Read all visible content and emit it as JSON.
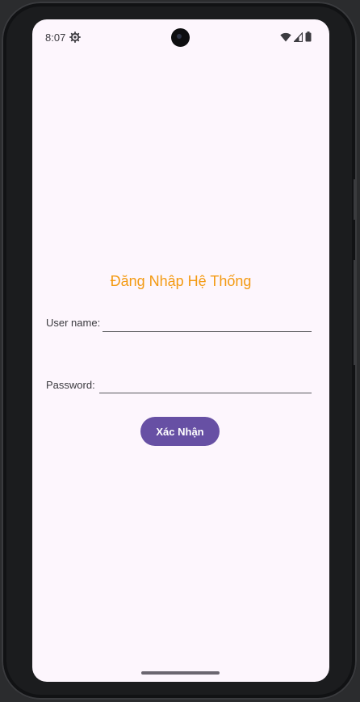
{
  "status_bar": {
    "time": "8:07",
    "icons": [
      "gear-icon",
      "wifi-icon",
      "cell-signal-icon",
      "battery-icon"
    ]
  },
  "login": {
    "title": "Đăng Nhập Hệ Thống",
    "username_label": "User name:",
    "username_value": "",
    "password_label": "Password:",
    "password_value": "",
    "confirm_button": "Xác Nhận"
  },
  "colors": {
    "screen_background": "#fdf6fd",
    "title": "#f39a12",
    "button": "#6750a4",
    "button_text": "#ffffff"
  }
}
